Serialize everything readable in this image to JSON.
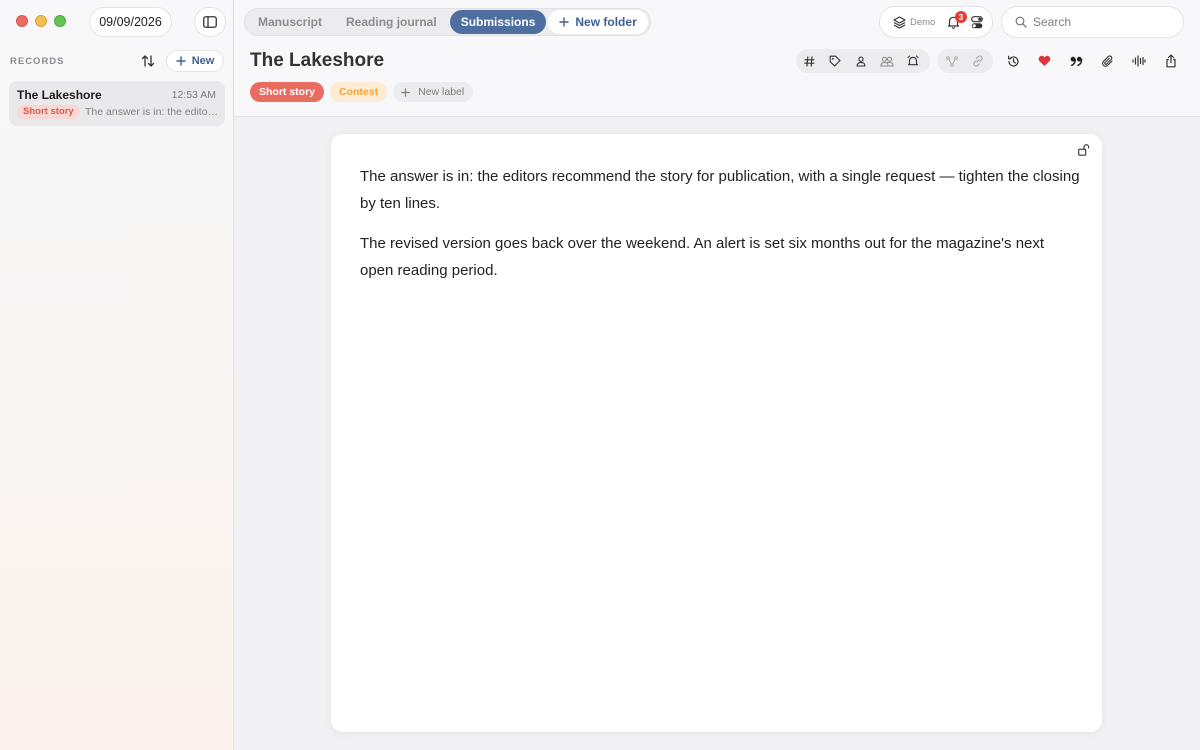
{
  "sidebar": {
    "date": "09/09/2026",
    "records_label": "RECORDS",
    "new_label": "New",
    "records": [
      {
        "title": "The Lakeshore",
        "time": "12:53 AM",
        "tag": "Short story",
        "snippet": "The answer is in: the editors recommend the story for publication, with a single request"
      }
    ]
  },
  "header": {
    "tabs": [
      {
        "label": "Manuscript",
        "active": false
      },
      {
        "label": "Reading journal",
        "active": false
      },
      {
        "label": "Submissions",
        "active": true
      }
    ],
    "new_folder_label": "New folder",
    "workspace": "Demo",
    "notification_count": "3",
    "search_placeholder": "Search"
  },
  "document": {
    "title": "The Lakeshore",
    "labels": [
      {
        "text": "Short story",
        "color": "#ea6b5f"
      },
      {
        "text": "Contest",
        "color": "#f0a640"
      }
    ],
    "new_label": "New label",
    "paragraphs": [
      "The answer is in: the editors recommend the story for publication, with a single request — tighten the closing by ten lines.",
      "The revised version goes back over the weekend. An alert is set six months out for the magazine's next open reading period."
    ],
    "favorited": true
  },
  "toolbar_icons": [
    "hashtag-icon",
    "tag-icon",
    "person-icon",
    "people-icon",
    "alarm-icon",
    "branch-icon",
    "link-icon",
    "history-icon",
    "heart-icon",
    "quote-icon",
    "paperclip-icon",
    "waveform-icon",
    "share-icon"
  ],
  "colors": {
    "accent": "#4e6e9f",
    "short_story": "#ea6b5f",
    "contest": "#f0a640",
    "badge": "#e43d34",
    "heart": "#e0333a"
  }
}
